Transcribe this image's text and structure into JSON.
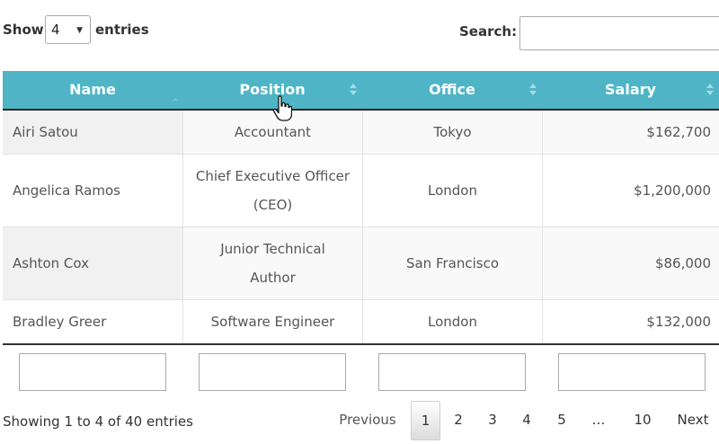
{
  "length_menu": {
    "show_label": "Show",
    "selected": "4",
    "entries_label": "entries"
  },
  "search": {
    "label": "Search:",
    "value": ""
  },
  "columns": [
    "Name",
    "Position",
    "Office",
    "Salary"
  ],
  "rows": [
    {
      "name": "Airi Satou",
      "position": "Accountant",
      "office": "Tokyo",
      "salary": "$162,700"
    },
    {
      "name": "Angelica Ramos",
      "position": "Chief Executive Officer (CEO)",
      "office": "London",
      "salary": "$1,200,000"
    },
    {
      "name": "Ashton Cox",
      "position": "Junior Technical Author",
      "office": "San Francisco",
      "salary": "$86,000"
    },
    {
      "name": "Bradley Greer",
      "position": "Software Engineer",
      "office": "London",
      "salary": "$132,000"
    }
  ],
  "info": "Showing 1 to 4 of 40 entries",
  "pagination": {
    "previous": "Previous",
    "pages": [
      "1",
      "2",
      "3",
      "4",
      "5",
      "…",
      "10"
    ],
    "current": "1",
    "next": "Next"
  },
  "colors": {
    "header_bg": "#4fb5c6",
    "header_text": "#ffffff"
  }
}
